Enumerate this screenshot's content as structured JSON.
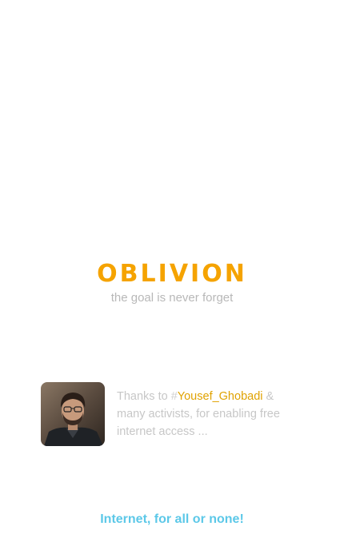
{
  "brand": {
    "title": "OBLIVION",
    "tagline": "the goal is never forget"
  },
  "credit": {
    "prefix": "Thanks to ",
    "hash": "#",
    "mention": "Yousef_Ghobadi",
    "suffix": " & many activists, for enabling free internet access ...",
    "avatar_icon": "person-portrait"
  },
  "footer": {
    "slogan": "Internet, for all or none!"
  },
  "colors": {
    "accent": "#f5a300",
    "mention": "#e0a200",
    "slogan": "#5cc8e8",
    "muted_text": "#c7c7c7"
  }
}
